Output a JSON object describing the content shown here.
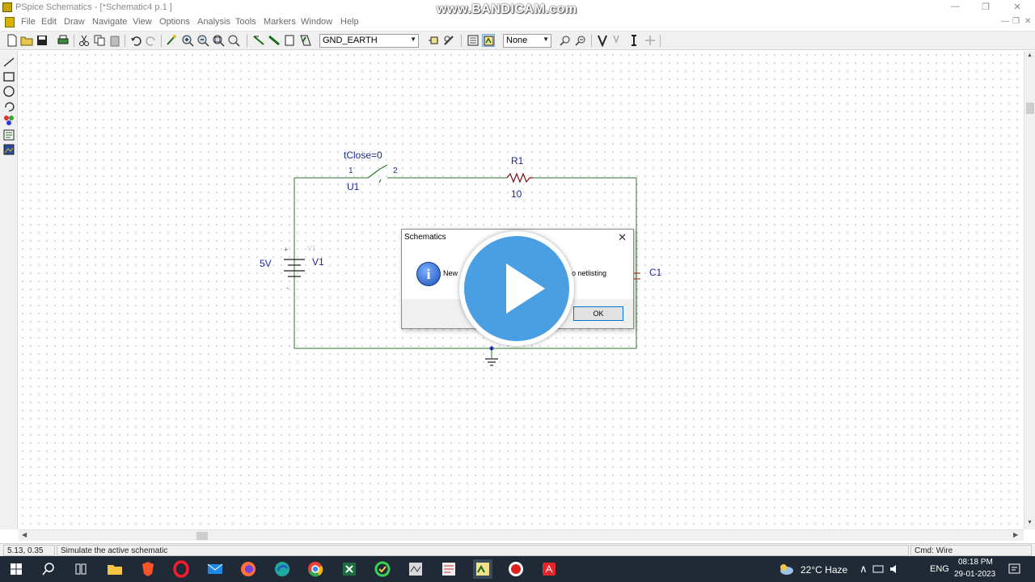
{
  "window": {
    "title": "PSpice Schematics - [*Schematic4  p.1  ]",
    "watermark": "www.BANDICAM.com",
    "minimize": "—",
    "maximize": "❐",
    "close": "✕"
  },
  "menu": {
    "items": [
      "File",
      "Edit",
      "Draw",
      "Navigate",
      "View",
      "Options",
      "Analysis",
      "Tools",
      "Markers",
      "Window",
      "Help"
    ],
    "mdi_minimize": "—",
    "mdi_restore": "❐",
    "mdi_close": "✕"
  },
  "toolbar": {
    "part_combo_value": "GND_EARTH",
    "marker_combo_value": "None"
  },
  "schematic": {
    "switch_param": "tClose=0",
    "switch_pin1": "1",
    "switch_pin2": "2",
    "switch_ref": "U1",
    "resistor_ref": "R1",
    "resistor_value": "10",
    "source_value": "5V",
    "source_ref": "V1",
    "source_ghost": "V1",
    "source_plus": "+",
    "source_minus": "-",
    "capacitor_ref": "C1"
  },
  "dialog": {
    "title": "Schematics",
    "close": "✕",
    "message_left": "New",
    "message_right": "o netlisting",
    "ok_label": "OK"
  },
  "status": {
    "coords": "5.13,  0.35",
    "message": "Simulate the active schematic",
    "cmd": "Cmd: Wire"
  },
  "taskbar": {
    "weather": "22°C  Haze",
    "language": "ENG",
    "time": "08:18 PM",
    "date": "29-01-2023",
    "tray_chevron": "∧"
  }
}
